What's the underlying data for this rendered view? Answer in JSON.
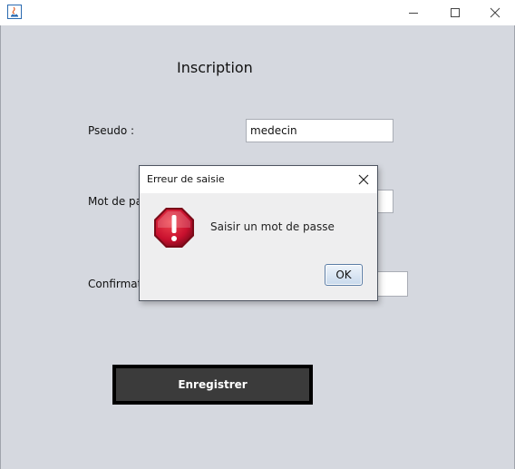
{
  "window": {
    "app_icon": "java-icon",
    "controls": [
      "minimize-icon",
      "maximize-icon",
      "close-icon"
    ]
  },
  "form": {
    "title": "Inscription",
    "pseudo_label": "Pseudo :",
    "pseudo_value": "medecin",
    "password_label": "Mot de passe :",
    "password_value": "",
    "confirm_label": "Confirmation :",
    "confirm_value": "",
    "register_button": "Enregistrer"
  },
  "dialog": {
    "title": "Erreur de saisie",
    "message": "Saisir un mot de passe",
    "ok_button": "OK",
    "icon": "error-icon",
    "close_icon": "close-icon"
  },
  "colors": {
    "window_bg": "#d5d8df",
    "button_bg": "#3b3b3b",
    "error_red": "#c8102e"
  }
}
